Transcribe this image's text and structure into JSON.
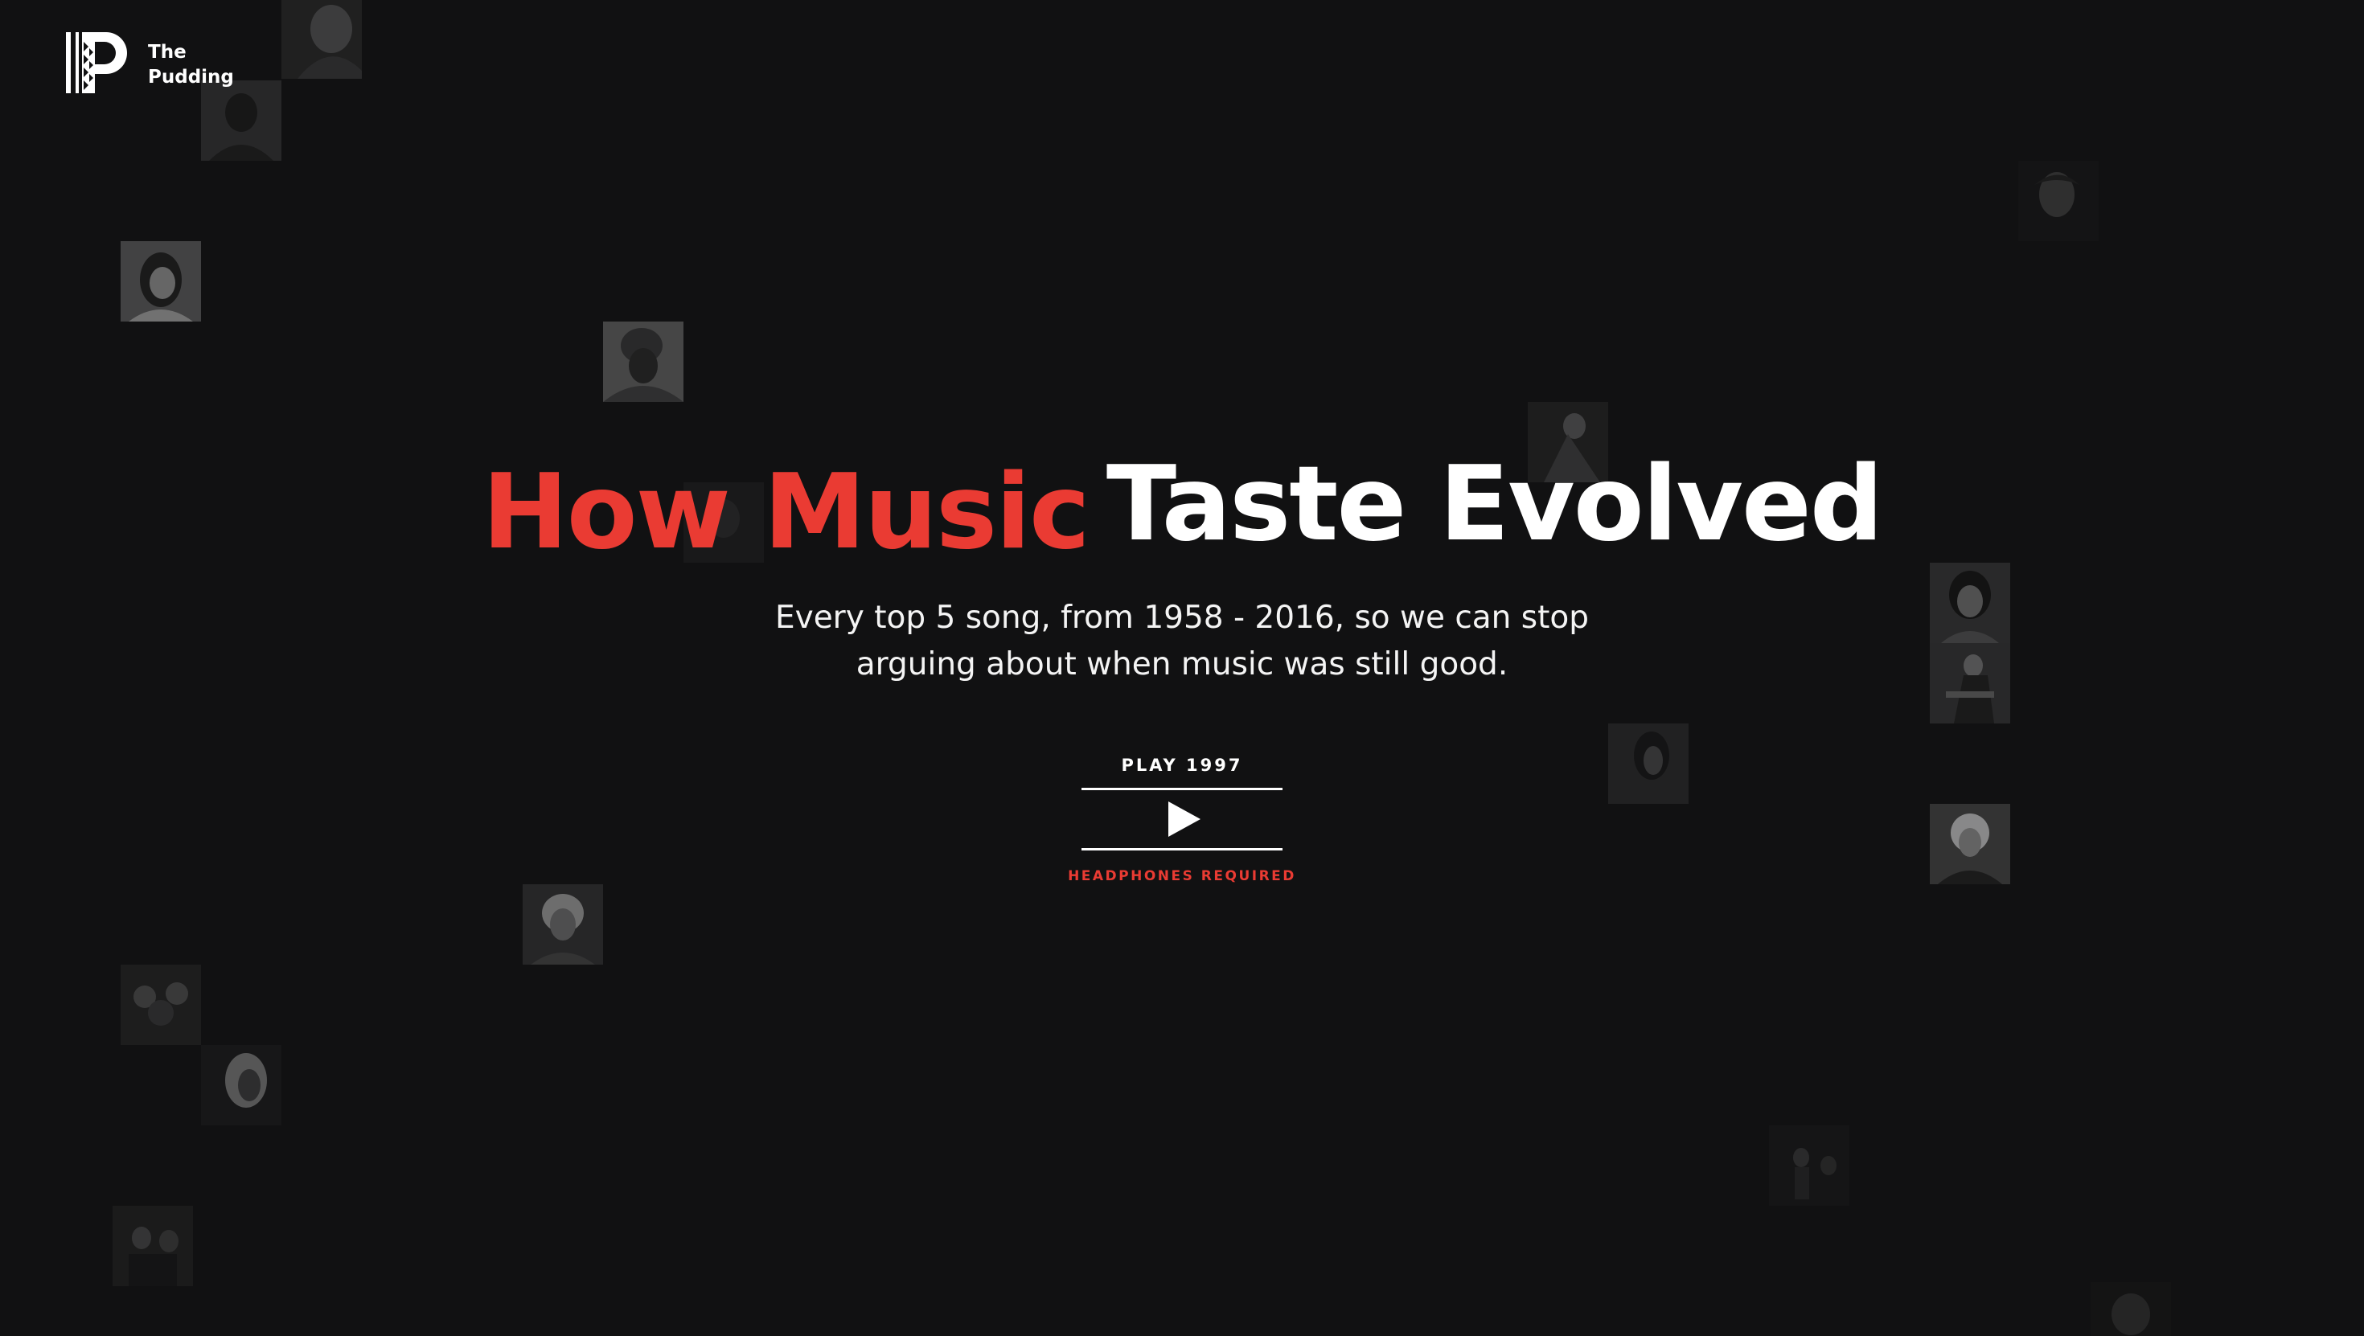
{
  "logo": {
    "line1": "The",
    "line2": "Pudding",
    "icon": "pudding-p-logo-icon"
  },
  "hero": {
    "title_highlight": "How Music",
    "title_rest": "Taste Evolved",
    "subtitle_line1": "Every top 5 song, from 1958 - 2016, so we can stop",
    "subtitle_line2": "arguing about when music was still good."
  },
  "player": {
    "label": "PLAY 1997",
    "note": "HEADPHONES REQUIRED",
    "icon": "play-icon"
  },
  "colors": {
    "background": "#111112",
    "accent": "#ea3b33",
    "text": "#ffffff"
  },
  "artist_tiles_icon": "artist-photo-icon"
}
